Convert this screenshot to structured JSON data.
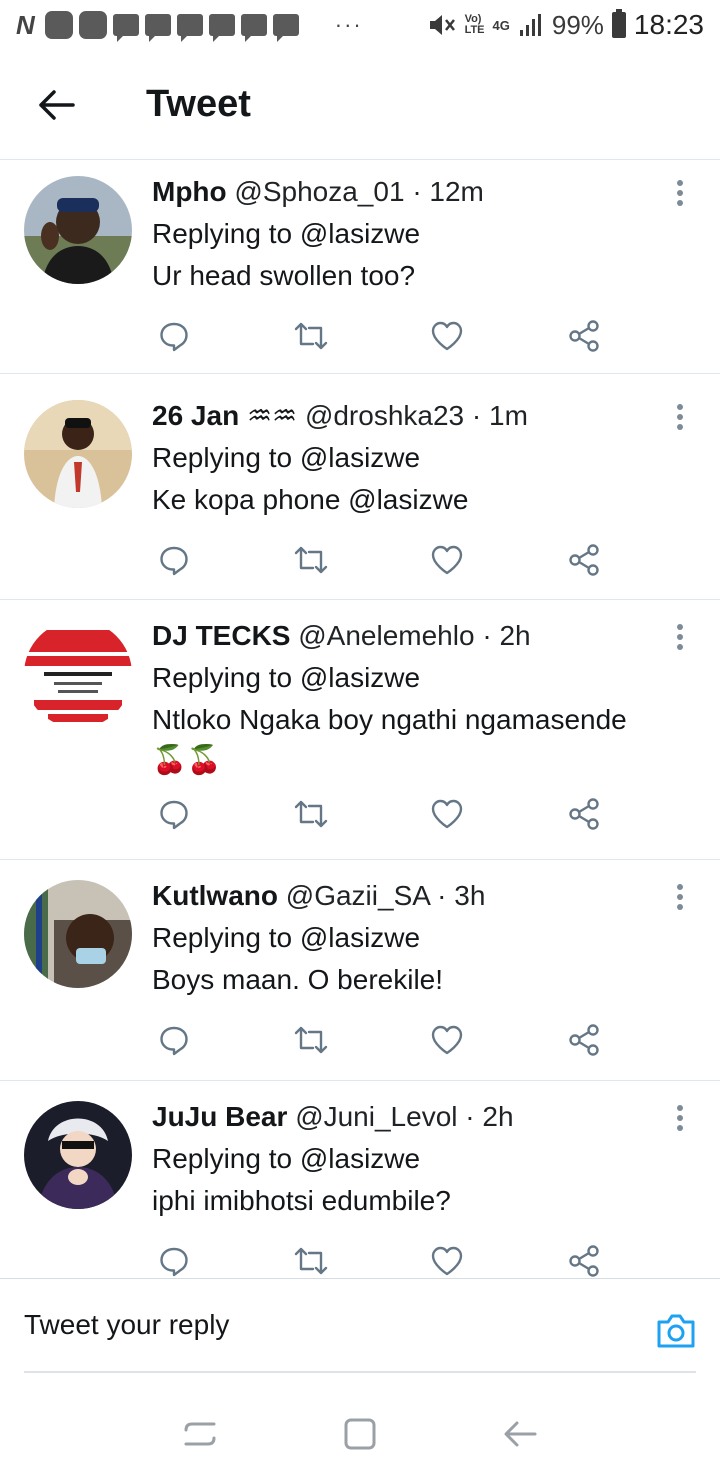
{
  "status_bar": {
    "network_logo": "N",
    "dots": "···",
    "volte_top": "Vo)",
    "volte_bottom": "LTE",
    "network_type": "4G",
    "battery": "99%",
    "time": "18:23"
  },
  "header": {
    "title": "Tweet"
  },
  "tweets": [
    {
      "name": "Mpho",
      "handle": "@Sphoza_01",
      "time": "· 12m",
      "replying": "Replying to @lasizwe",
      "text": "Ur head swollen too?",
      "emoji": ""
    },
    {
      "name": "26 Jan ♒♒",
      "handle": "@droshka23",
      "time": "· 1m",
      "replying": "Replying to @lasizwe",
      "text": "Ke kopa phone @lasizwe",
      "emoji": ""
    },
    {
      "name": "DJ TECKS",
      "handle": "@Anelemehlo",
      "time": "· 2h",
      "replying": "Replying to @lasizwe",
      "text": "Ntloko Ngaka boy ngathi ngamasende",
      "emoji": "🍒🍒"
    },
    {
      "name": "Kutlwano",
      "handle": "@Gazii_SA",
      "time": "· 3h",
      "replying": "Replying to @lasizwe",
      "text": "Boys maan. O berekile!",
      "emoji": ""
    },
    {
      "name": "JuJu Bear",
      "handle": "@Juni_Levol",
      "time": "· 2h",
      "replying": "Replying to @lasizwe",
      "text": "iphi imibhotsi edumbile?",
      "emoji": ""
    }
  ],
  "reply_bar": {
    "placeholder": "Tweet your reply"
  },
  "colors": {
    "accent": "#1da1f2",
    "icon_gray": "#657786",
    "divider": "#e1e8ed"
  }
}
